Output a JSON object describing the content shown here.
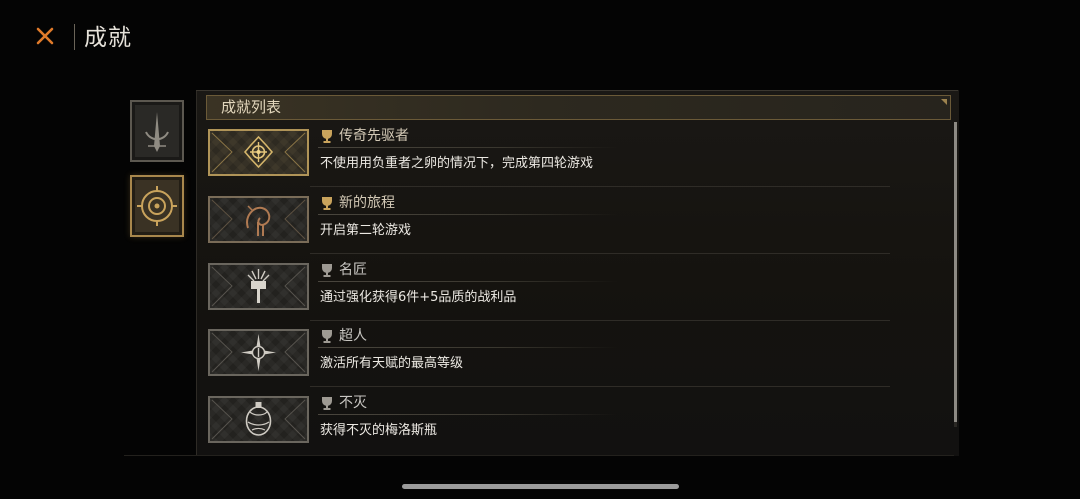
{
  "header": {
    "title": "成就"
  },
  "categories": [
    {
      "icon": "crescent-spire-icon",
      "state": "inactive"
    },
    {
      "icon": "rune-circle-icon",
      "state": "active"
    }
  ],
  "list": {
    "title": "成就列表",
    "items": [
      {
        "name": "传奇先驱者",
        "description": "不使用用负重者之卵的情况下，完成第四轮游戏",
        "icon": "gold-emblem-icon",
        "unlocked": true
      },
      {
        "name": "新的旅程",
        "description": "开启第二轮游戏",
        "icon": "serpent-rune-icon",
        "unlocked": true
      },
      {
        "name": "名匠",
        "description": "通过强化获得6件+5品质的战利品",
        "icon": "hammer-sigil-icon",
        "unlocked": false
      },
      {
        "name": "超人",
        "description": "激活所有天赋的最高等级",
        "icon": "star-sigil-icon",
        "unlocked": false
      },
      {
        "name": "不灭",
        "description": "获得不灭的梅洛斯瓶",
        "icon": "flask-sigil-icon",
        "unlocked": false
      }
    ]
  },
  "colors": {
    "accent_gold": "#b09458",
    "name_unlocked": "#d3c9b6",
    "name_locked": "#c8c6c2",
    "close_icon": "#e07a2a"
  }
}
